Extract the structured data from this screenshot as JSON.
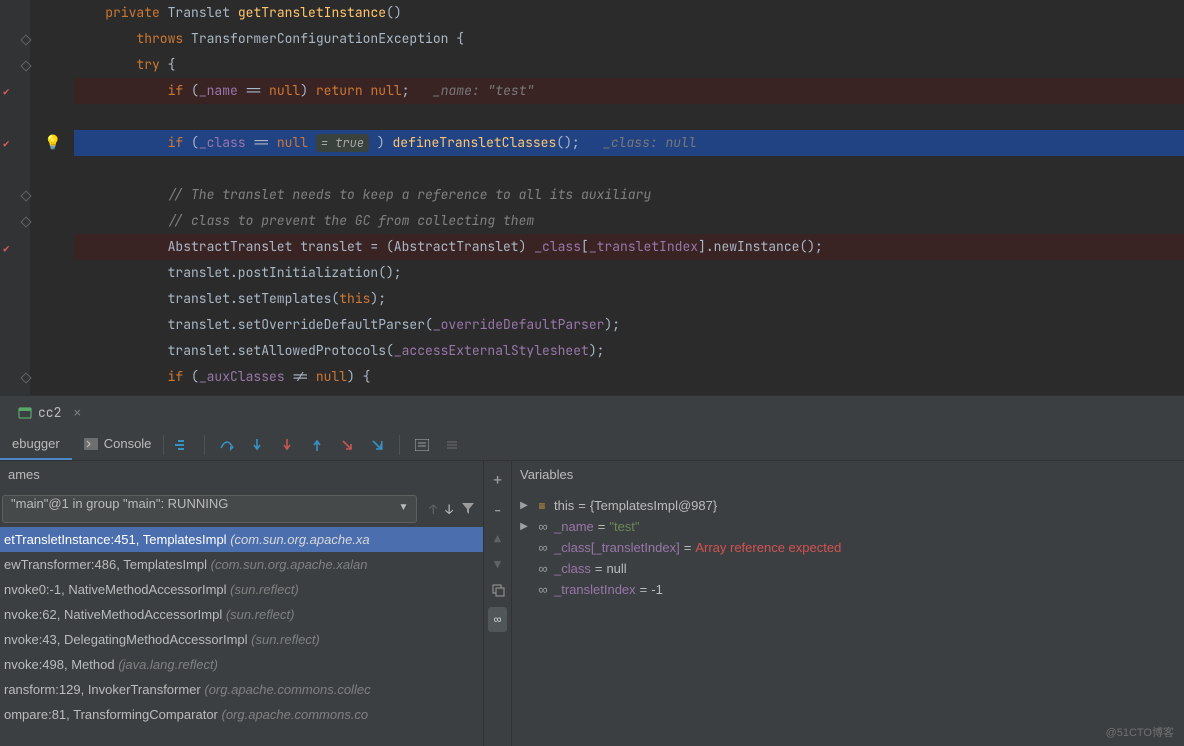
{
  "editor": {
    "lines": [
      {
        "indent": 4,
        "tokens": [
          [
            "kw",
            "private"
          ],
          [
            "txt",
            " "
          ],
          [
            "type",
            "Translet"
          ],
          [
            "txt",
            " "
          ],
          [
            "method",
            "getTransletInstance"
          ],
          [
            "txt",
            "()"
          ]
        ]
      },
      {
        "indent": 8,
        "tokens": [
          [
            "kw",
            "throws"
          ],
          [
            "txt",
            " TransformerConfigurationException {"
          ]
        ]
      },
      {
        "indent": 8,
        "tokens": [
          [
            "kw",
            "try"
          ],
          [
            "txt",
            " {"
          ]
        ]
      },
      {
        "indent": 12,
        "bp": true,
        "tokens": [
          [
            "kw",
            "if"
          ],
          [
            "txt",
            " ("
          ],
          [
            "field",
            "_name"
          ],
          [
            "txt",
            " == "
          ],
          [
            "kw",
            "null"
          ],
          [
            "txt",
            ") "
          ],
          [
            "kw",
            "return"
          ],
          [
            "txt",
            " "
          ],
          [
            "kw",
            "null"
          ],
          [
            "txt",
            ";   "
          ],
          [
            "hint",
            "_name: \"test\""
          ]
        ]
      },
      {
        "indent": 0,
        "tokens": []
      },
      {
        "indent": 12,
        "bp": true,
        "current": true,
        "bulb": true,
        "tokens": [
          [
            "kw",
            "if"
          ],
          [
            "txt",
            " ("
          ],
          [
            "field",
            "_class"
          ],
          [
            "txt",
            " == "
          ],
          [
            "kw",
            "null"
          ],
          [
            "txt",
            " "
          ],
          [
            "eval",
            "= true"
          ],
          [
            "txt",
            " ) "
          ],
          [
            "method",
            "defineTransletClasses"
          ],
          [
            "txt",
            "();   "
          ],
          [
            "hint",
            "_class: null"
          ]
        ]
      },
      {
        "indent": 0,
        "tokens": []
      },
      {
        "indent": 12,
        "tokens": [
          [
            "comment",
            "// The translet needs to keep a reference to all its auxiliary"
          ]
        ]
      },
      {
        "indent": 12,
        "tokens": [
          [
            "comment",
            "// class to prevent the GC from collecting them"
          ]
        ]
      },
      {
        "indent": 12,
        "bp": true,
        "tokens": [
          [
            "txt",
            "AbstractTranslet translet = (AbstractTranslet) "
          ],
          [
            "field",
            "_class"
          ],
          [
            "txt",
            "["
          ],
          [
            "field",
            "_transletIndex"
          ],
          [
            "txt",
            "].newInstance();"
          ]
        ]
      },
      {
        "indent": 12,
        "tokens": [
          [
            "txt",
            "translet.postInitialization();"
          ]
        ]
      },
      {
        "indent": 12,
        "tokens": [
          [
            "txt",
            "translet.setTemplates("
          ],
          [
            "kw",
            "this"
          ],
          [
            "txt",
            ");"
          ]
        ]
      },
      {
        "indent": 12,
        "tokens": [
          [
            "txt",
            "translet.setOverrideDefaultParser("
          ],
          [
            "field",
            "_overrideDefaultParser"
          ],
          [
            "txt",
            ");"
          ]
        ]
      },
      {
        "indent": 12,
        "tokens": [
          [
            "txt",
            "translet.setAllowedProtocols("
          ],
          [
            "field",
            "_accessExternalStylesheet"
          ],
          [
            "txt",
            ");"
          ]
        ]
      },
      {
        "indent": 12,
        "tokens": [
          [
            "kw",
            "if"
          ],
          [
            "txt",
            " ("
          ],
          [
            "field",
            "_auxClasses"
          ],
          [
            "txt",
            " != "
          ],
          [
            "kw",
            "null"
          ],
          [
            "txt",
            ") {"
          ]
        ]
      }
    ]
  },
  "runTab": {
    "label": "cc2"
  },
  "debugTabs": {
    "debugger": "ebugger",
    "console": "Console"
  },
  "frames": {
    "header": "ames",
    "thread": "\"main\"@1 in group \"main\": RUNNING",
    "items": [
      {
        "name": "etTransletInstance:451, TemplatesImpl",
        "pkg": "(com.sun.org.apache.xa",
        "selected": true
      },
      {
        "name": "ewTransformer:486, TemplatesImpl",
        "pkg": "(com.sun.org.apache.xalan"
      },
      {
        "name": "nvoke0:-1, NativeMethodAccessorImpl",
        "pkg": "(sun.reflect)"
      },
      {
        "name": "nvoke:62, NativeMethodAccessorImpl",
        "pkg": "(sun.reflect)"
      },
      {
        "name": "nvoke:43, DelegatingMethodAccessorImpl",
        "pkg": "(sun.reflect)"
      },
      {
        "name": "nvoke:498, Method",
        "pkg": "(java.lang.reflect)"
      },
      {
        "name": "ransform:129, InvokerTransformer",
        "pkg": "(org.apache.commons.collec"
      },
      {
        "name": "ompare:81, TransformingComparator",
        "pkg": "(org.apache.commons.co"
      }
    ]
  },
  "variables": {
    "header": "Variables",
    "items": [
      {
        "icon": "bars",
        "expand": true,
        "name": "this",
        "nameClass": "var-this",
        "eq": " = ",
        "val": "{TemplatesImpl@987}",
        "valClass": "var-val"
      },
      {
        "icon": "glasses",
        "expand": true,
        "name": "_name",
        "nameClass": "var-name",
        "eq": " = ",
        "val": "\"test\"",
        "valClass": "var-str"
      },
      {
        "icon": "glasses",
        "expand": false,
        "name": "_class[_transletIndex]",
        "nameClass": "var-name",
        "eq": " = ",
        "val": "Array reference expected",
        "valClass": "var-err"
      },
      {
        "icon": "glasses",
        "expand": false,
        "name": "_class",
        "nameClass": "var-name",
        "eq": " = ",
        "val": "null",
        "valClass": "var-val"
      },
      {
        "icon": "glasses",
        "expand": false,
        "name": "_transletIndex",
        "nameClass": "var-name",
        "eq": " = ",
        "val": "-1",
        "valClass": "var-val"
      }
    ]
  },
  "watermark": "@51CTO博客"
}
